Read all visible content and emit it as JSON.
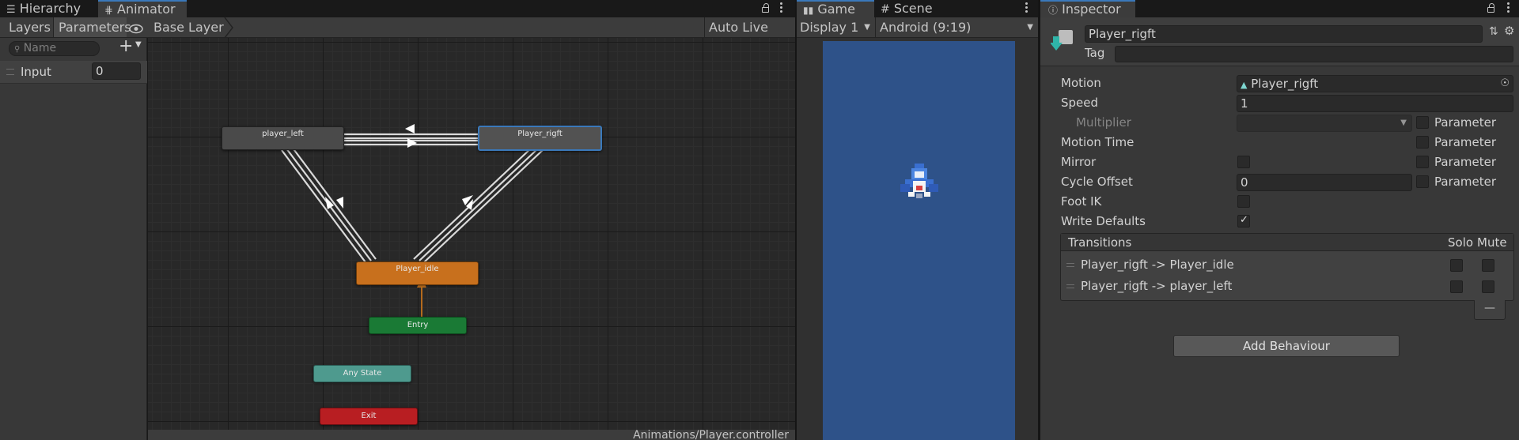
{
  "tabs": {
    "hierarchy": "Hierarchy",
    "animator": "Animator",
    "game": "Game",
    "scene": "Scene",
    "inspector": "Inspector"
  },
  "animator": {
    "layers_tab": "Layers",
    "parameters_tab": "Parameters",
    "breadcrumb": "Base Layer",
    "auto_live_link": "Auto Live Link",
    "search_placeholder": "Name",
    "parameters": [
      {
        "name": "Input",
        "value": "0"
      }
    ],
    "states": {
      "player_left": "player_left",
      "player_rigft": "Player_rigft",
      "player_idle": "Player_idle",
      "entry": "Entry",
      "any_state": "Any State",
      "exit": "Exit"
    },
    "footer_path": "Animations/Player.controller",
    "colors": {
      "default_state": "#4a4a4a",
      "idle_state": "#c8701d",
      "entry": "#1a7a35",
      "any_state": "#4e9a8e",
      "exit": "#b81e22",
      "selected_outline": "#3a79bb"
    }
  },
  "game": {
    "display": "Display 1",
    "resolution": "Android (9:19)",
    "colors": {
      "background": "#2e5289"
    }
  },
  "inspector": {
    "object_name": "Player_rigft",
    "tag_label": "Tag",
    "tag_value": "",
    "motion_label": "Motion",
    "motion_value": "Player_rigft",
    "speed_label": "Speed",
    "speed_value": "1",
    "multiplier_label": "Multiplier",
    "multiplier_value": "",
    "motion_time_label": "Motion Time",
    "mirror_label": "Mirror",
    "cycle_offset_label": "Cycle Offset",
    "cycle_offset_value": "0",
    "foot_ik_label": "Foot IK",
    "write_defaults_label": "Write Defaults",
    "write_defaults_checked": true,
    "parameter_label": "Parameter",
    "transitions_header": "Transitions",
    "solo_label": "Solo",
    "mute_label": "Mute",
    "transitions": [
      {
        "label": "Player_rigft -> Player_idle"
      },
      {
        "label": "Player_rigft -> player_left"
      }
    ],
    "remove_symbol": "—",
    "add_behaviour": "Add Behaviour"
  }
}
